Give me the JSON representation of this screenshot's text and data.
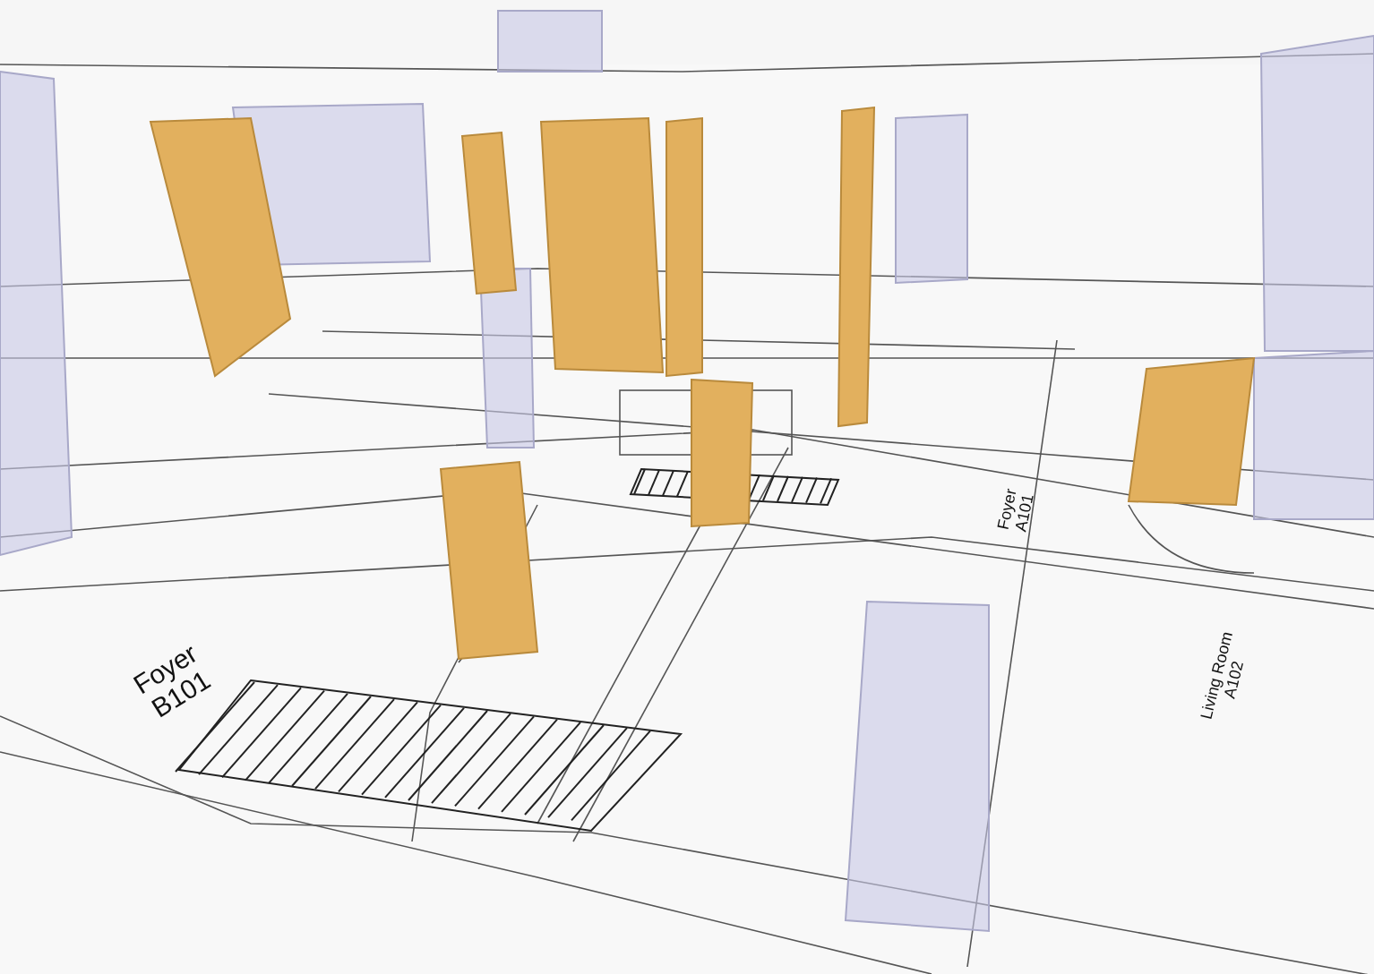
{
  "rooms": [
    {
      "name": "Foyer",
      "number": "B101"
    },
    {
      "name": "Foyer",
      "number": "A101"
    },
    {
      "name": "Living Room",
      "number": "A102"
    }
  ]
}
